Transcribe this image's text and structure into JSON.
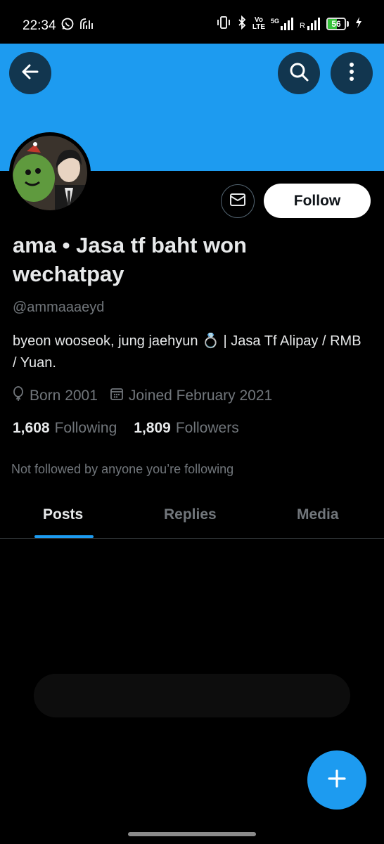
{
  "status_bar": {
    "time": "22:34",
    "signal_label": "R",
    "volte_line1": "Vo",
    "volte_line2": "LTE",
    "network": "5G",
    "battery": "56",
    "battery_level": 0.56,
    "battery_color": "#35c23a"
  },
  "header": {
    "banner_color": "#1d9bf0",
    "back_icon": "arrow-left-icon",
    "search_icon": "search-icon",
    "more_icon": "more-vertical-icon"
  },
  "profile": {
    "display_name": "ama • Jasa tf baht won wechatpay",
    "handle": "@ammaaaeyd",
    "bio": "byeon wooseok, jung jaehyun 💍 | Jasa Tf Alipay / RMB / Yuan.",
    "born": "Born 2001",
    "joined": "Joined February 2021",
    "following_count": "1,608",
    "following_label": "Following",
    "followers_count": "1,809",
    "followers_label": "Followers",
    "not_followed": "Not followed by anyone you’re following"
  },
  "actions": {
    "follow_label": "Follow",
    "message_icon": "mail-icon"
  },
  "tabs": [
    {
      "label": "Posts",
      "active": true
    },
    {
      "label": "Replies",
      "active": false
    },
    {
      "label": "Media",
      "active": false
    }
  ],
  "fab": {
    "icon": "plus-icon",
    "color": "#1d9bf0"
  }
}
